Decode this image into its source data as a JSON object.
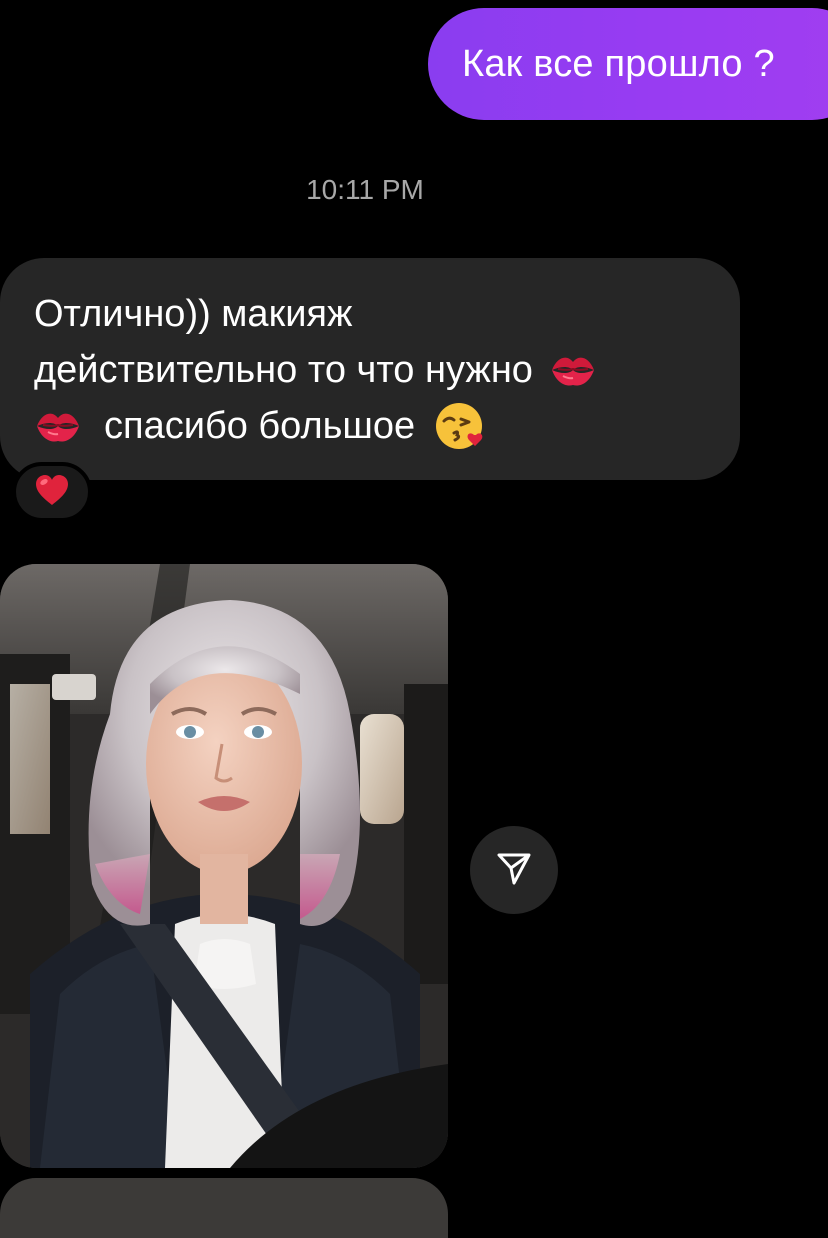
{
  "thread": {
    "outgoing_message": "Как все прошло ?",
    "timestamp": "10:11 PM",
    "incoming_message": {
      "line1": "Отлично)) макияж",
      "line2": "действительно то что нужно",
      "line3": "спасибо большое"
    },
    "incoming_emojis": [
      "kiss-mark-icon",
      "kiss-mark-icon",
      "face-blowing-kiss-icon"
    ],
    "reaction": "red-heart-icon",
    "shared_media": {
      "type": "photo",
      "icon": "send-icon"
    }
  },
  "colors": {
    "background": "#000000",
    "outgoing_bubble": "#9a3cf2",
    "incoming_bubble": "#262626",
    "timestamp": "#a8a8a8"
  }
}
